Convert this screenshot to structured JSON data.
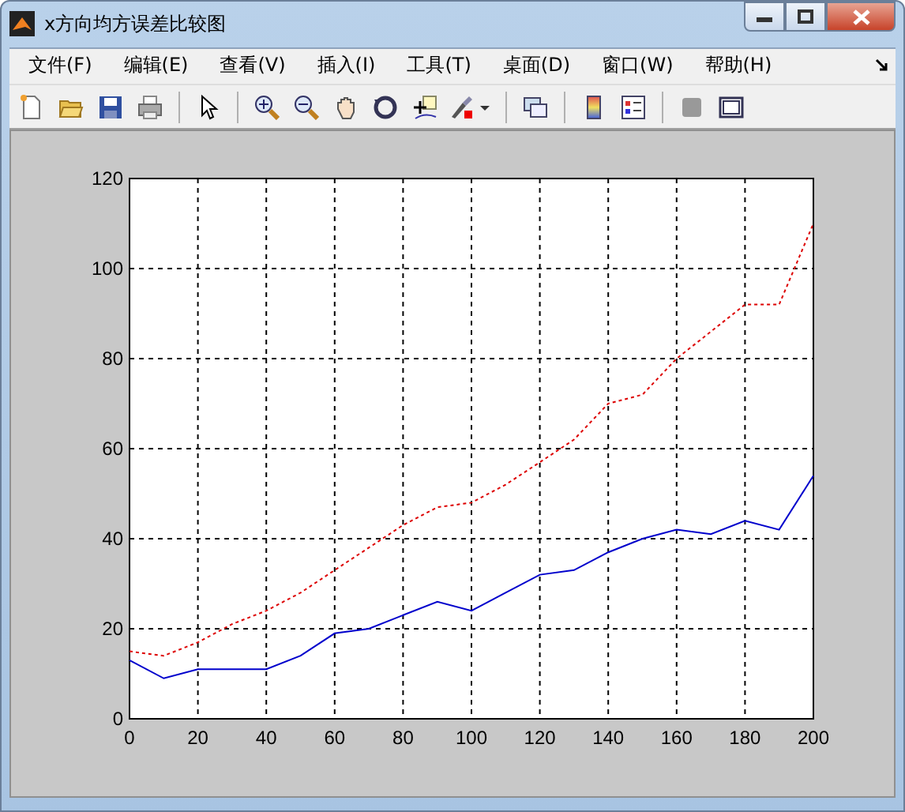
{
  "window": {
    "title": "x方向均方误差比较图"
  },
  "menu": [
    {
      "label": "文件(F)"
    },
    {
      "label": "编辑(E)"
    },
    {
      "label": "查看(V)"
    },
    {
      "label": "插入(I)"
    },
    {
      "label": "工具(T)"
    },
    {
      "label": "桌面(D)"
    },
    {
      "label": "窗口(W)"
    },
    {
      "label": "帮助(H)"
    }
  ],
  "plot": {
    "chart_data": {
      "type": "line",
      "x": [
        0,
        10,
        20,
        30,
        40,
        50,
        60,
        70,
        80,
        90,
        100,
        110,
        120,
        130,
        140,
        150,
        160,
        170,
        180,
        190,
        200
      ],
      "series": [
        {
          "color": "#0000cc",
          "line_style": "solid",
          "values": [
            13,
            9,
            11,
            11,
            11,
            14,
            19,
            20,
            23,
            26,
            24,
            28,
            32,
            33,
            37,
            40,
            42,
            41,
            44,
            42,
            54
          ]
        },
        {
          "color": "#dd0000",
          "line_style": "dotted",
          "values": [
            15,
            14,
            17,
            21,
            24,
            28,
            33,
            38,
            43,
            47,
            48,
            52,
            57,
            62,
            70,
            72,
            80,
            86,
            92,
            92,
            110
          ]
        }
      ],
      "grid": true,
      "xlim": [
        0,
        200
      ],
      "ylim": [
        0,
        120
      ],
      "xticks": [
        0,
        20,
        40,
        60,
        80,
        100,
        120,
        140,
        160,
        180,
        200
      ],
      "yticks": [
        0,
        20,
        40,
        60,
        80,
        100,
        120
      ]
    }
  }
}
